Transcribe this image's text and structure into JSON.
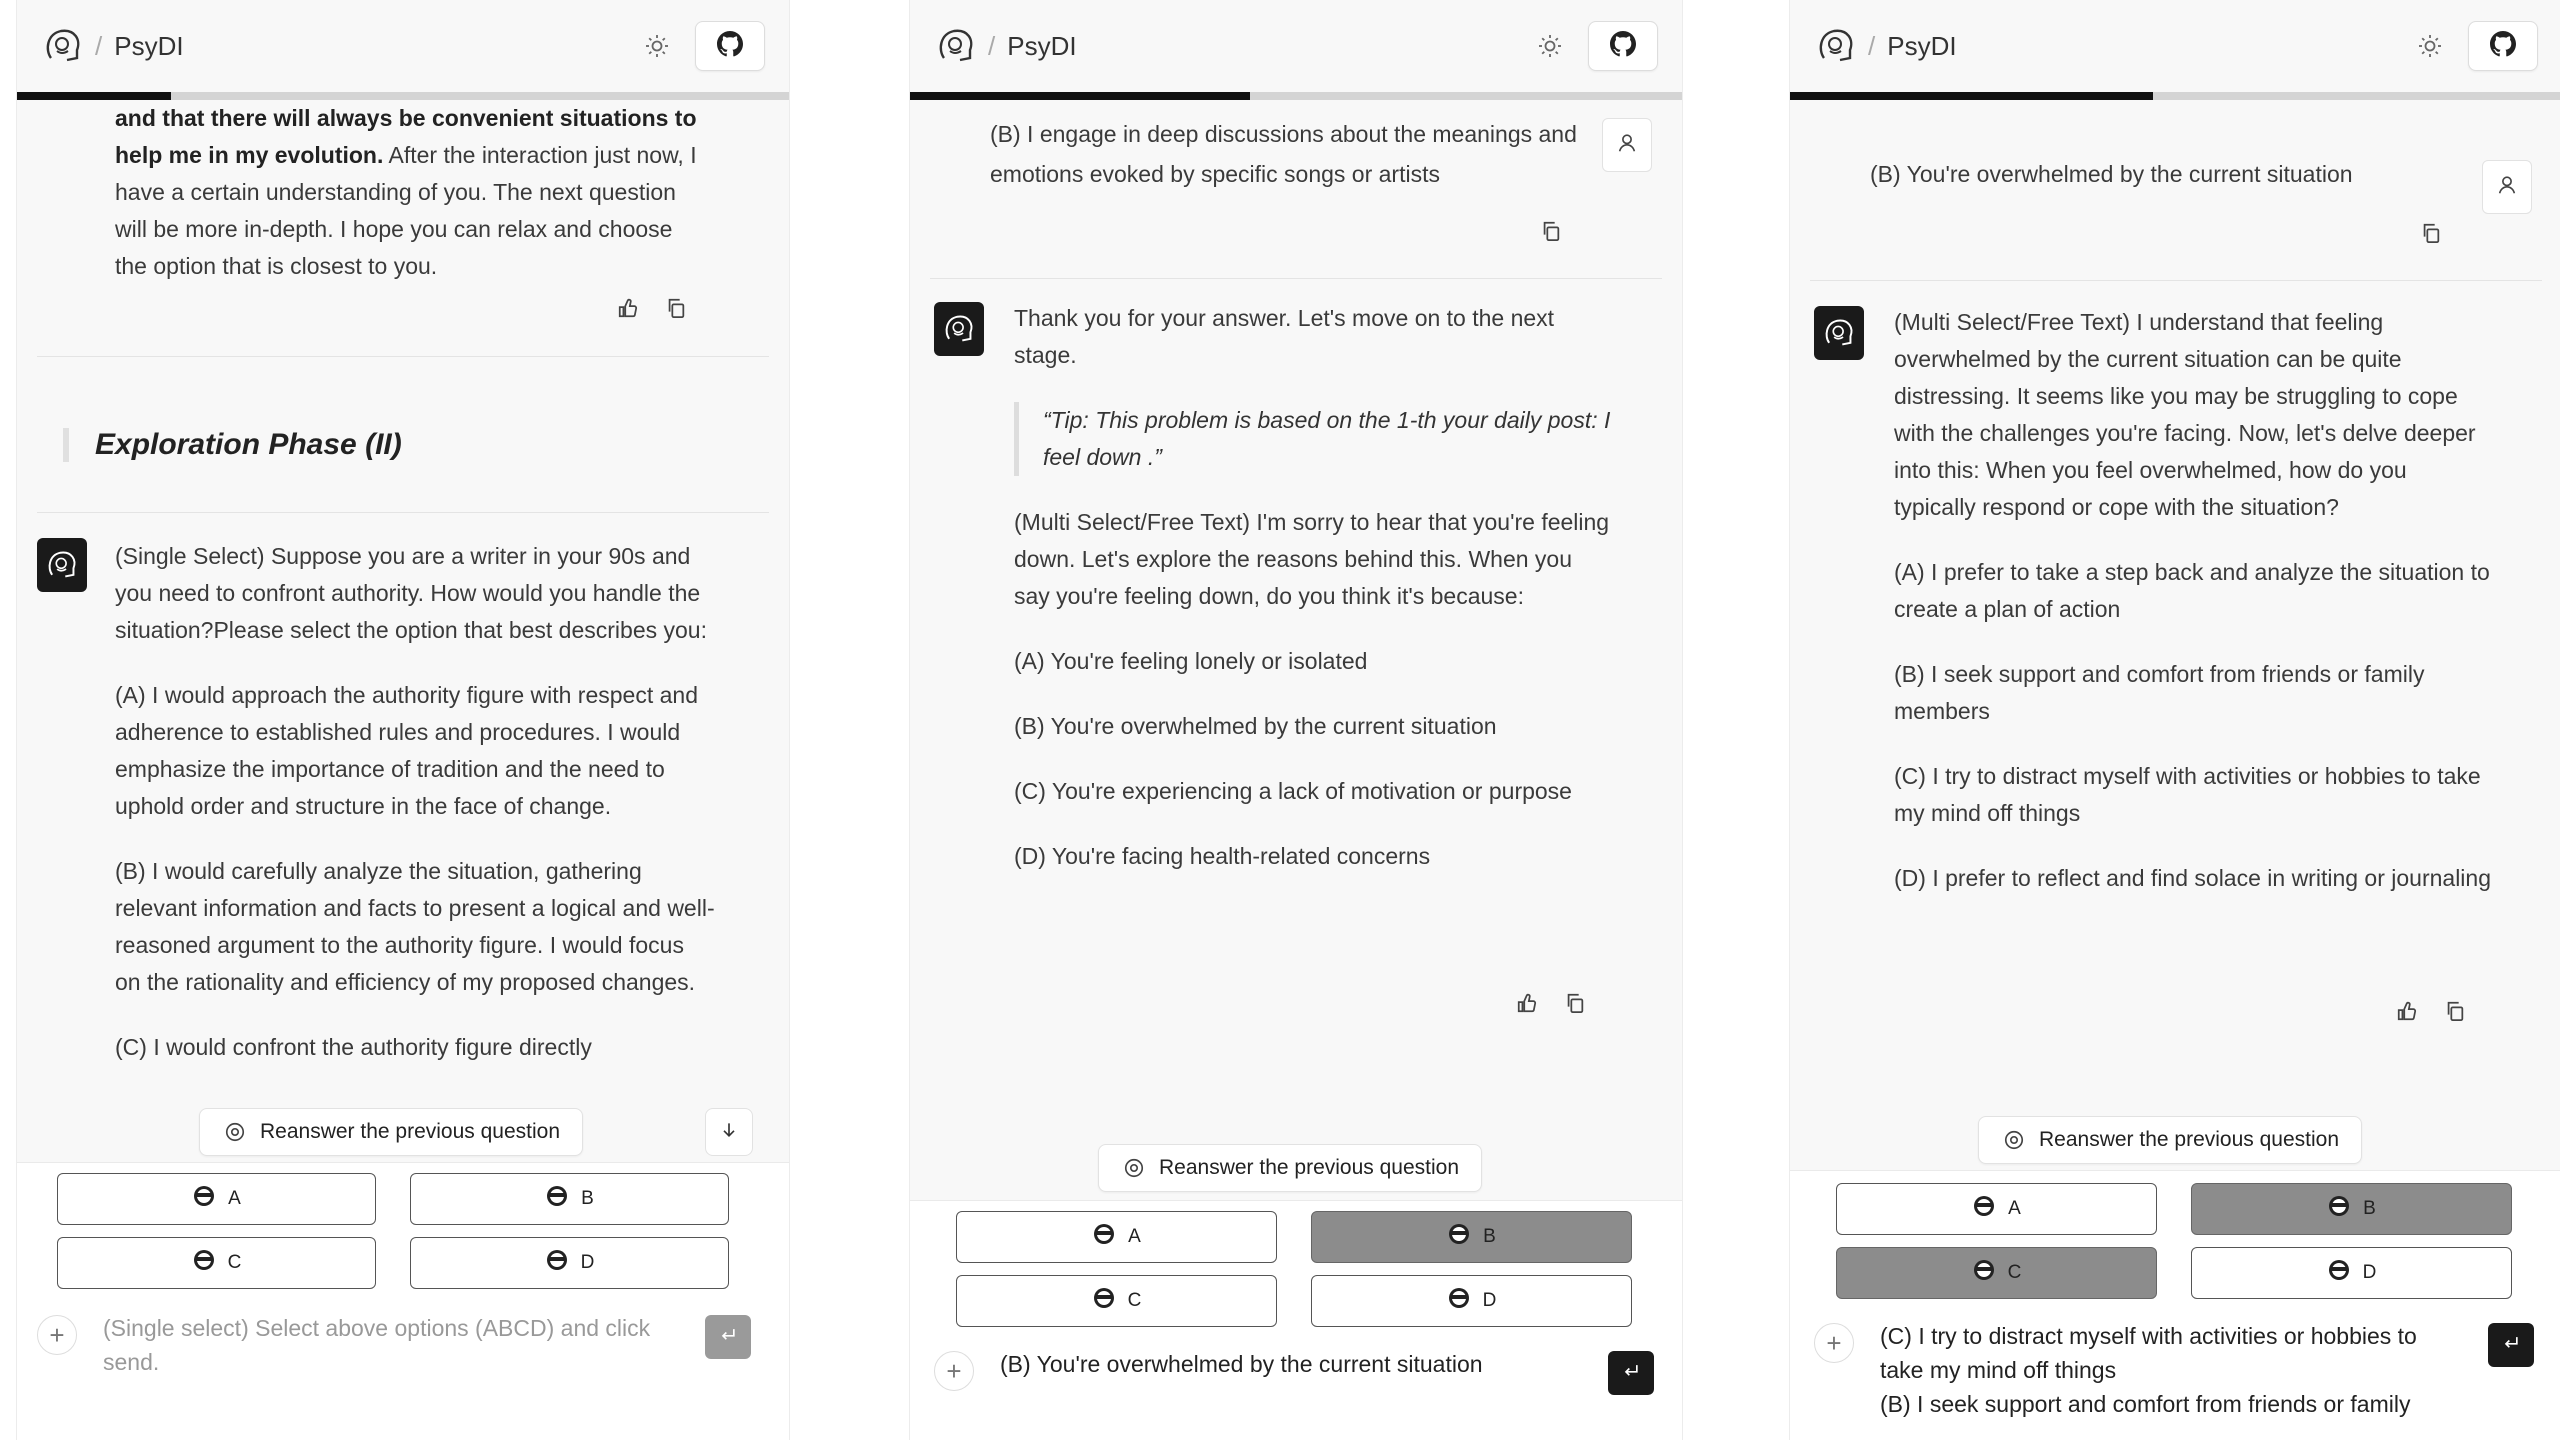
{
  "app": {
    "brand": "PsyDI"
  },
  "panel1": {
    "msg_top_bold": "and that there will always be convenient situations to help me in my evolution.",
    "msg_top_rest": " After the interaction just now, I have a certain understanding of you. The next question will be more in-depth. I hope you can relax and choose the option that is closest to you.",
    "phase_title": "Exploration Phase (II)",
    "question": "(Single Select) Suppose you are a writer in your 90s and you need to confront authority. How would you handle the situation?Please select the option that best describes you:",
    "option_a": "(A) I would approach the authority figure with respect and adherence to established rules and procedures. I would emphasize the importance of tradition and the need to uphold order and structure in the face of change.",
    "option_b": "(B) I would carefully analyze the situation, gathering relevant information and facts to present a logical and well-reasoned argument to the authority figure. I would focus on the rationality and efficiency of my proposed changes.",
    "option_c_partial": "(C) I would confront the authority figure directly",
    "reanswer": "Reanswer the previous question",
    "choices": [
      "A",
      "B",
      "C",
      "D"
    ],
    "input_placeholder": "(Single select) Select above options (ABCD) and click send."
  },
  "panel2": {
    "user_msg": "(B) I engage in deep discussions about the meanings and emotions evoked by specific songs or artists",
    "intro": "Thank you for your answer. Let's move on to the next stage.",
    "tip": "“Tip: This problem is based on the 1-th your daily post: I feel down .”",
    "question": "(Multi Select/Free Text) I'm sorry to hear that you're feeling down. Let's explore the reasons behind this. When you say you're feeling down, do you think it's because:",
    "option_a": "(A) You're feeling lonely or isolated",
    "option_b": "(B) You're overwhelmed by the current situation",
    "option_c": "(C) You're experiencing a lack of motivation or purpose",
    "option_d": "(D) You're facing health-related concerns",
    "reanswer": "Reanswer the previous question",
    "choices": [
      "A",
      "B",
      "C",
      "D"
    ],
    "input_value": "(B) You're overwhelmed by the current situation"
  },
  "panel3": {
    "user_msg": "(B) You're overwhelmed by the current situation",
    "question": "(Multi Select/Free Text) I understand that feeling overwhelmed by the current situation can be quite distressing. It seems like you may be struggling to cope with the challenges you're facing. Now, let's delve deeper into this: When you feel overwhelmed, how do you typically respond or cope with the situation?",
    "option_a": "(A) I prefer to take a step back and analyze the situation to create a plan of action",
    "option_b": "(B) I seek support and comfort from friends or family members",
    "option_c": "(C) I try to distract myself with activities or hobbies to take my mind off things",
    "option_d": "(D) I prefer to reflect and find solace in writing or journaling",
    "reanswer": "Reanswer the previous question",
    "choices": [
      "A",
      "B",
      "C",
      "D"
    ],
    "input_line1": "(C) I try to distract myself with activities or hobbies to take my mind off things",
    "input_line2": "(B) I seek support and comfort from friends or family"
  },
  "progress": {
    "panel1": 0.2,
    "panel2": 0.44,
    "panel3": 0.47
  },
  "colors": {
    "accent": "#111111",
    "selected": "#8c8c8c",
    "background": "#f8f8f8"
  },
  "icons": [
    "psydi-logo-icon",
    "sun-icon",
    "github-icon",
    "thumbs-up-icon",
    "copy-icon",
    "user-icon",
    "target-icon",
    "arrow-down-icon",
    "face-icon",
    "plus-icon",
    "enter-icon"
  ]
}
